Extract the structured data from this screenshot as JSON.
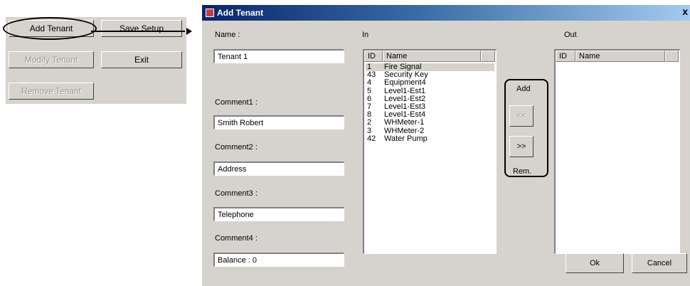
{
  "toolbar": {
    "add_tenant": "Add Tenant",
    "save_setup": "Save Setup",
    "modify_tenant": "Modify Tenant",
    "exit": "Exit",
    "remove_tenant": "Remove Tenant"
  },
  "dialog": {
    "title": "Add Tenant",
    "close": "x",
    "name_label": "Name :",
    "name_value": "Tenant 1",
    "comment1_label": "Comment1 :",
    "comment1_value": "Smith Robert",
    "comment2_label": "Comment2 :",
    "comment2_value": "Address",
    "comment3_label": "Comment3 :",
    "comment3_value": "Telephone",
    "comment4_label": "Comment4 :",
    "comment4_value": "Balance : 0",
    "in_label": "In",
    "out_label": "Out",
    "col_id": "ID",
    "col_name": "Name",
    "in_items": [
      {
        "id": "1",
        "name": "Fire Signal"
      },
      {
        "id": "43",
        "name": "Security Key"
      },
      {
        "id": "4",
        "name": "Equipment4"
      },
      {
        "id": "5",
        "name": "Level1-Est1"
      },
      {
        "id": "6",
        "name": "Level1-Est2"
      },
      {
        "id": "7",
        "name": "Level1-Est3"
      },
      {
        "id": "8",
        "name": "Level1-Est4"
      },
      {
        "id": "2",
        "name": "WHMeter-1"
      },
      {
        "id": "3",
        "name": "WHMeter-2"
      },
      {
        "id": "42",
        "name": "Water Pump"
      }
    ],
    "add_label": "Add",
    "rem_label": "Rem.",
    "move_left": "<<",
    "move_right": ">>",
    "ok": "Ok",
    "cancel": "Cancel"
  }
}
